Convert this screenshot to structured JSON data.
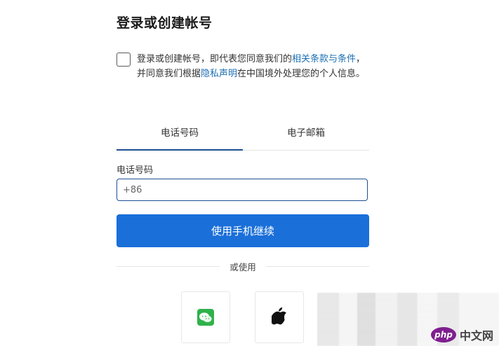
{
  "header": {
    "title": "登录或创建帐号"
  },
  "consent": {
    "text_part_1": "登录或创建帐号，即代表您同意我们的",
    "terms_link": "相关条款与条件",
    "text_part_2": "，并同意我们根据",
    "privacy_link": "隐私声明",
    "text_part_3": "在中国境外处理您的个人信息。",
    "checked": false
  },
  "tabs": [
    {
      "label": "电话号码",
      "active": true
    },
    {
      "label": "电子邮箱",
      "active": false
    }
  ],
  "phone": {
    "label": "电话号码",
    "value": "+86"
  },
  "primary_action": {
    "label": "使用手机继续"
  },
  "alt_login": {
    "divider_text": "或使用",
    "buttons": [
      {
        "name": "wechat",
        "icon": "wechat-icon"
      },
      {
        "name": "apple",
        "icon": "apple-icon"
      }
    ]
  },
  "watermark": {
    "brand": "php",
    "text": "中文网"
  },
  "colors": {
    "primary": "#1a6fd9",
    "tab_active": "#1d4f91",
    "link": "#1c6fb5",
    "wechat": "#2fb24b"
  }
}
